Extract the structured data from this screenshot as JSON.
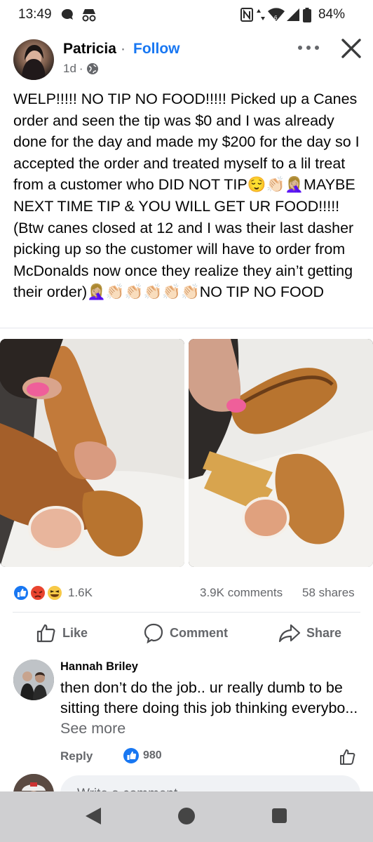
{
  "status_bar": {
    "time": "13:49",
    "battery": "84%",
    "icons": [
      "chat-bubble-icon",
      "incognito-icon",
      "nfc-icon",
      "data-arrows-icon",
      "wifi-6-icon",
      "signal-icon",
      "battery-icon"
    ]
  },
  "post": {
    "author": "Patricia",
    "separator": "·",
    "follow_label": "Follow",
    "time": "1d",
    "meta_separator": "·",
    "audience_icon": "globe-icon",
    "text": "WELP!!!!! NO TIP NO FOOD!!!!! Picked up a Canes order and seen the tip was $0 and I was already done for the day and made my $200 for the day so I accepted the order and treated myself to a lil treat from a customer who DID NOT TIP😌👏🏻🤦🏼‍♀️MAYBE NEXT TIME TIP & YOU WILL GET UR FOOD!!!!! (Btw canes closed at 12 and I was their last dasher picking up so the customer will have to order from McDonalds now once they realize they ain’t getting their order)🤦🏼‍♀️👏🏻👏🏻👏🏻👏🏻👏🏻NO TIP NO FOOD",
    "photos": [
      "chicken-tender-dipped-in-sauce",
      "texas-toast-with-fries-and-tenders"
    ]
  },
  "stats": {
    "reactions": "1.6K",
    "comments": "3.9K comments",
    "shares": "58 shares"
  },
  "actions": {
    "like": "Like",
    "comment": "Comment",
    "share": "Share"
  },
  "comment": {
    "name": "Hannah Briley",
    "text": "then don’t do the job.. ur really dumb to be sitting there doing this job thinking everybo...",
    "see_more": "See more",
    "reply": "Reply",
    "likes": "980"
  },
  "composer": {
    "placeholder": "Write a comment..."
  },
  "colors": {
    "brand": "#1877f2",
    "secondary_text": "#65676b",
    "nav_bar": "#cfcfd1"
  }
}
